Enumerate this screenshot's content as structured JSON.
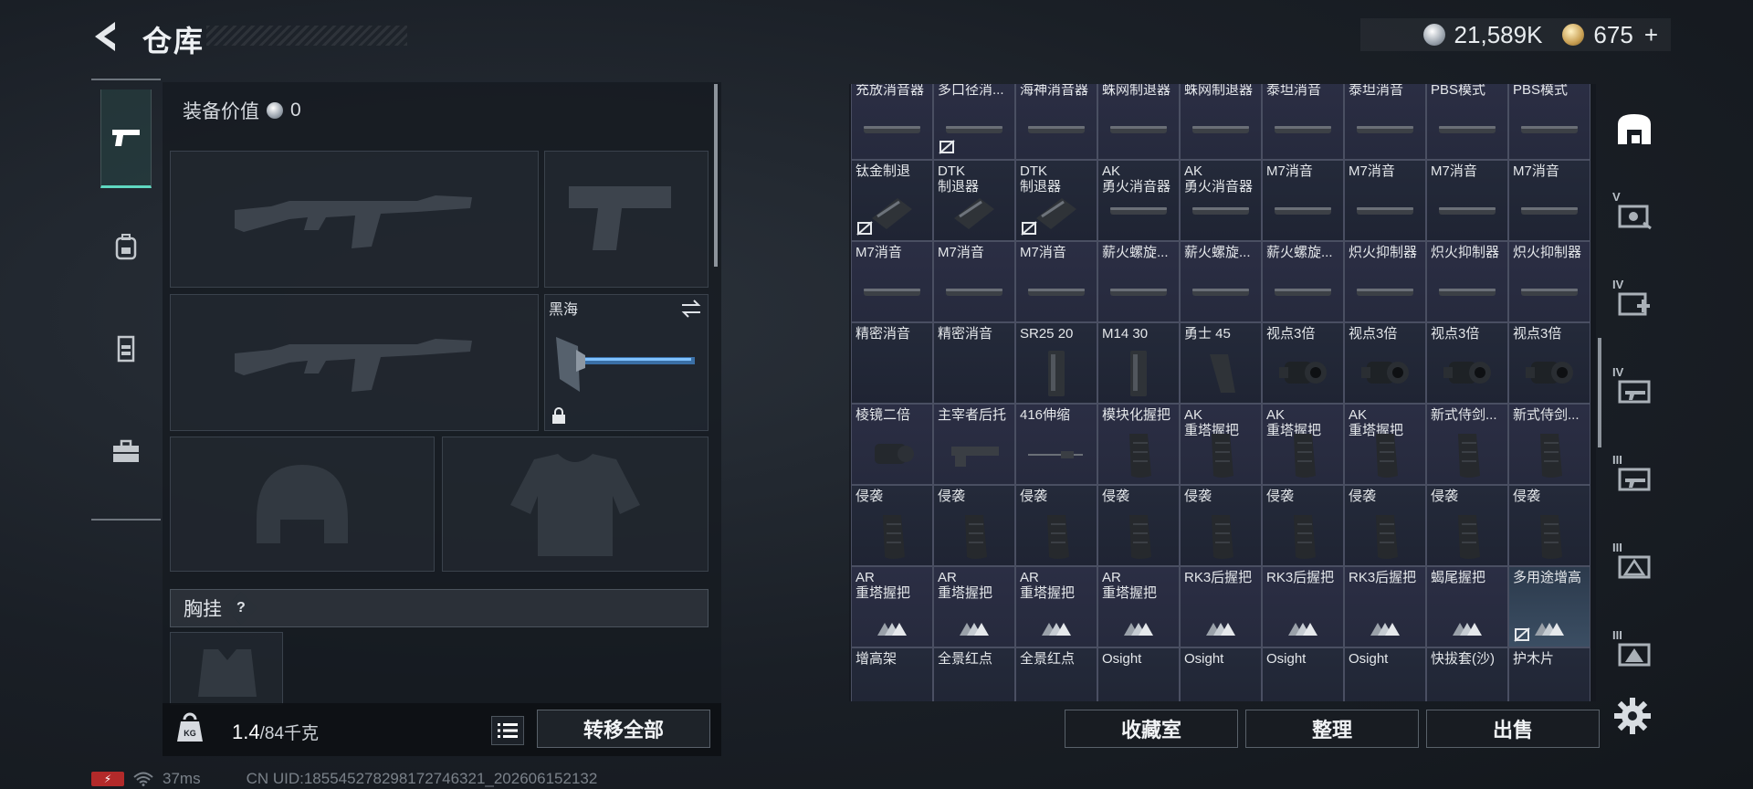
{
  "header": {
    "title": "仓库"
  },
  "currency": {
    "silver_value": "21,589K",
    "gold_value": "675",
    "gold_plus": "+"
  },
  "left_tabs": [
    {
      "icon": "pistol-icon",
      "active": true
    },
    {
      "icon": "backpack-icon",
      "active": false
    },
    {
      "icon": "vest-icon",
      "active": false
    },
    {
      "icon": "toolbox-icon",
      "active": false
    }
  ],
  "loadout": {
    "equip_value_label": "装备价值",
    "equip_value": "0",
    "melee_name": "黑海",
    "chest_label": "胸挂",
    "help": "?",
    "weight_current": "1.4",
    "weight_max": "/84千克",
    "transfer_all": "转移全部"
  },
  "status": {
    "ping": "37ms",
    "uid": "CN UID:1855452782981727463​21_202606152132"
  },
  "storage": {
    "items": [
      "充放消音器",
      "多口径消...",
      "海神消音器",
      "蛛网制退器",
      "蛛网制退器",
      "泰坦消音",
      "泰坦消音",
      "PBS模式",
      "PBS模式",
      "钛金制退",
      "DTK\n制退器",
      "DTK\n制退器",
      "AK\n勇火消音器",
      "AK\n勇火消音器",
      "M7消音",
      "M7消音",
      "M7消音",
      "M7消音",
      "M7消音",
      "M7消音",
      "M7消音",
      "薪火螺旋...",
      "薪火螺旋...",
      "薪火螺旋...",
      "炽火抑制器",
      "炽火抑制器",
      "炽火抑制器",
      "精密消音",
      "精密消音",
      "SR25 20",
      "M14 30",
      "勇士 45",
      "视点3倍",
      "视点3倍",
      "视点3倍",
      "视点3倍",
      "棱镜二倍",
      "主宰者后托",
      "416伸缩",
      "模块化握把",
      "AK\n重塔握把",
      "AK\n重塔握把",
      "AK\n重塔握把",
      "新式侍剑...",
      "新式侍剑...",
      "侵袭",
      "侵袭",
      "侵袭",
      "侵袭",
      "侵袭",
      "侵袭",
      "侵袭",
      "侵袭",
      "侵袭",
      "AR\n重塔握把",
      "AR\n重塔握把",
      "AR\n重塔握把",
      "AR\n重塔握把",
      "RK3后握把",
      "RK3后握把",
      "RK3后握把",
      "蝎尾握把",
      "多用途增高",
      "增高架",
      "全景红点",
      "全景红点",
      "Osight",
      "Osight",
      "Osight",
      "Osight",
      "快拔套(沙)",
      "护木片"
    ]
  },
  "actions": {
    "collection": "收藏室",
    "sort": "整理",
    "sell": "出售"
  },
  "right_rail": [
    {
      "icon": "warehouse-icon",
      "tier": ""
    },
    {
      "icon": "tier-v-case-icon",
      "tier": "V"
    },
    {
      "icon": "tier-iv-medkit-icon",
      "tier": "IV"
    },
    {
      "icon": "tier-iv-weapon-icon",
      "tier": "IV"
    },
    {
      "icon": "tier-iii-weapon-icon",
      "tier": "III"
    },
    {
      "icon": "tier-iii-warning-icon",
      "tier": "III"
    },
    {
      "icon": "tier-iii-box-icon",
      "tier": "III"
    }
  ]
}
